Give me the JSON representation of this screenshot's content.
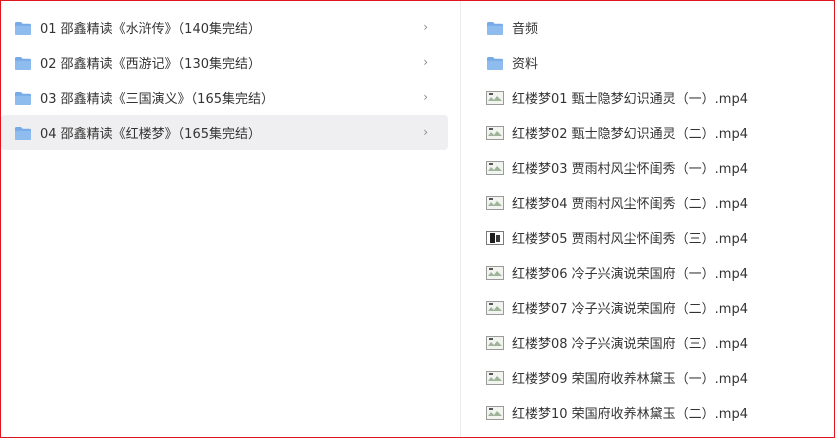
{
  "folders_left": [
    {
      "label": "01 邵鑫精读《水浒传》（140集完结）",
      "selected": false
    },
    {
      "label": "02 邵鑫精读《西游记》（130集完结）",
      "selected": false
    },
    {
      "label": "03 邵鑫精读《三国演义》（165集完结）",
      "selected": false
    },
    {
      "label": "04 邵鑫精读《红楼梦》（165集完结）",
      "selected": true
    }
  ],
  "chevron_glyph": "›",
  "right_folders": [
    {
      "label": "音频"
    },
    {
      "label": "资料"
    }
  ],
  "right_files": [
    {
      "label": "红楼梦01 甄士隐梦幻识通灵（一）.mp4",
      "thumb": "video-thumb-icon"
    },
    {
      "label": "红楼梦02 甄士隐梦幻识通灵（二）.mp4",
      "thumb": "video-thumb-icon"
    },
    {
      "label": "红楼梦03 贾雨村风尘怀闺秀（一）.mp4",
      "thumb": "video-thumb-icon"
    },
    {
      "label": "红楼梦04 贾雨村风尘怀闺秀（二）.mp4",
      "thumb": "video-thumb-icon"
    },
    {
      "label": "红楼梦05 贾雨村风尘怀闺秀（三）.mp4",
      "thumb": "video-thumb-dark-icon"
    },
    {
      "label": "红楼梦06 冷子兴演说荣国府（一）.mp4",
      "thumb": "video-thumb-icon"
    },
    {
      "label": "红楼梦07 冷子兴演说荣国府（二）.mp4",
      "thumb": "video-thumb-icon"
    },
    {
      "label": "红楼梦08 冷子兴演说荣国府（三）.mp4",
      "thumb": "video-thumb-icon"
    },
    {
      "label": "红楼梦09 荣国府收养林黛玉（一）.mp4",
      "thumb": "video-thumb-icon"
    },
    {
      "label": "红楼梦10 荣国府收养林黛玉（二）.mp4",
      "thumb": "video-thumb-icon"
    }
  ],
  "colors": {
    "folder": "#76abe8",
    "frame": "#e0161e",
    "selected_bg": "#efeff1"
  }
}
